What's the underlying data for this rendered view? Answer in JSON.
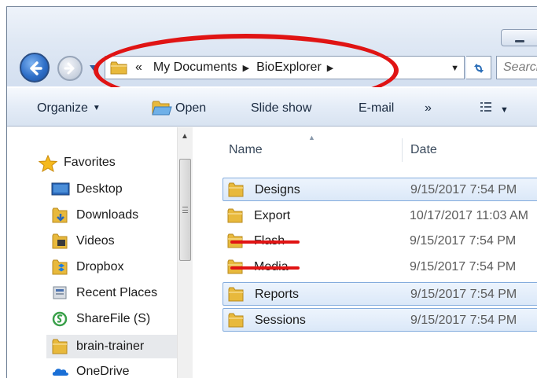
{
  "address_bar": {
    "overflow_label": "«",
    "breadcrumbs": [
      "My Documents",
      "BioExplorer"
    ]
  },
  "search": {
    "placeholder": "Search"
  },
  "toolbar": {
    "organize": "Organize",
    "open": "Open",
    "slideshow": "Slide show",
    "email": "E-mail",
    "more": "»"
  },
  "nav_pane": {
    "favorites": "Favorites",
    "items": [
      {
        "label": "Desktop",
        "icon": "desktop-icon"
      },
      {
        "label": "Downloads",
        "icon": "downloads-folder-icon"
      },
      {
        "label": "Videos",
        "icon": "videos-folder-icon"
      },
      {
        "label": "Dropbox",
        "icon": "dropbox-icon"
      },
      {
        "label": "Recent Places",
        "icon": "recent-places-icon"
      },
      {
        "label": "ShareFile (S)",
        "icon": "sharefile-icon"
      },
      {
        "label": "brain-trainer",
        "icon": "folder-icon"
      },
      {
        "label": "OneDrive",
        "icon": "onedrive-icon"
      }
    ]
  },
  "file_list": {
    "columns": {
      "name": "Name",
      "date": "Date"
    },
    "rows": [
      {
        "name": "Designs",
        "date": "9/15/2017 7:54 PM",
        "selected": true,
        "struck": false
      },
      {
        "name": "Export",
        "date": "10/17/2017 11:03 AM",
        "selected": false,
        "struck": false
      },
      {
        "name": "Flash",
        "date": "9/15/2017 7:54 PM",
        "selected": false,
        "struck": true
      },
      {
        "name": "Media",
        "date": "9/15/2017 7:54 PM",
        "selected": false,
        "struck": true
      },
      {
        "name": "Reports",
        "date": "9/15/2017 7:54 PM",
        "selected": true,
        "struck": false
      },
      {
        "name": "Sessions",
        "date": "9/15/2017 7:54 PM",
        "selected": true,
        "struck": false
      }
    ]
  },
  "colors": {
    "annotation_red": "#e01414",
    "selection_border": "#84acdd",
    "folder_yellow": "#e8b93c"
  }
}
